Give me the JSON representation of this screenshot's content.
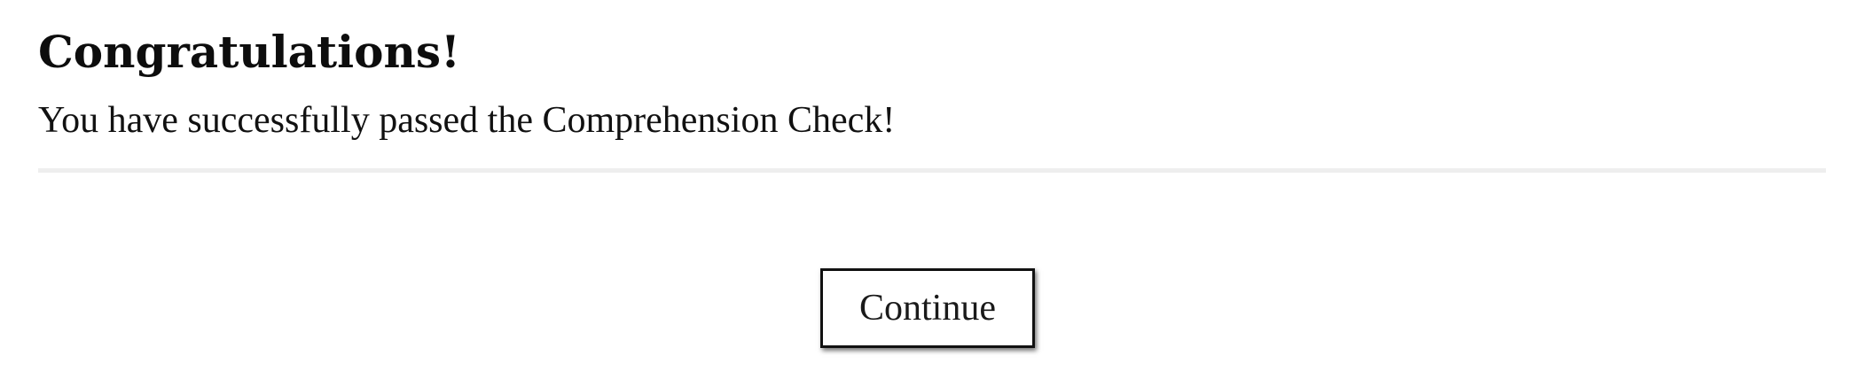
{
  "heading": "Congratulations!",
  "message": "You have successfully passed the Comprehension Check!",
  "continue_button": {
    "label": "Continue"
  },
  "colors": {
    "text": "#111111",
    "divider": "#eeeeee",
    "background": "#ffffff"
  }
}
